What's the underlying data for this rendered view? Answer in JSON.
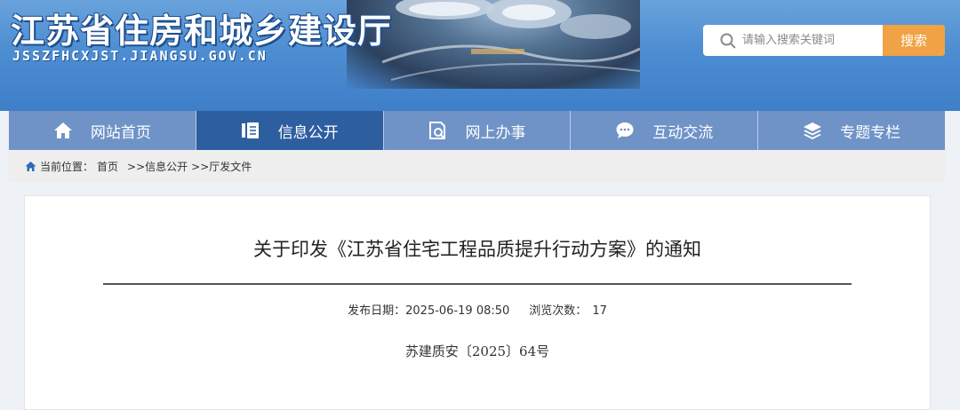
{
  "header": {
    "site_title": "江苏省住房和城乡建设厅",
    "site_domain": "JSSZFHCXJST.JIANGSU.GOV.CN",
    "search": {
      "placeholder": "请输入搜索关键词",
      "button_label": "搜索"
    }
  },
  "nav": {
    "items": [
      {
        "label": "网站首页",
        "icon": "home-icon"
      },
      {
        "label": "信息公开",
        "icon": "document-icon",
        "active": true
      },
      {
        "label": "网上办事",
        "icon": "service-search-icon"
      },
      {
        "label": "互动交流",
        "icon": "chat-icon"
      },
      {
        "label": "专题专栏",
        "icon": "layers-icon"
      }
    ]
  },
  "breadcrumb": {
    "prefix": "当前位置：",
    "items": [
      "首页",
      ">>信息公开",
      ">>厅发文件"
    ]
  },
  "article": {
    "title": "关于印发《江苏省住宅工程品质提升行动方案》的通知",
    "publish_label": "发布日期：",
    "publish_date": "2025-06-19 08:50",
    "views_label": "浏览次数：",
    "views": "17",
    "doc_number": "苏建质安〔2025〕64号"
  },
  "colors": {
    "banner": "#4d8dd2",
    "nav_bg": "#6f93c6",
    "nav_active": "#2d5e9f",
    "search_button": "#f0a244"
  }
}
